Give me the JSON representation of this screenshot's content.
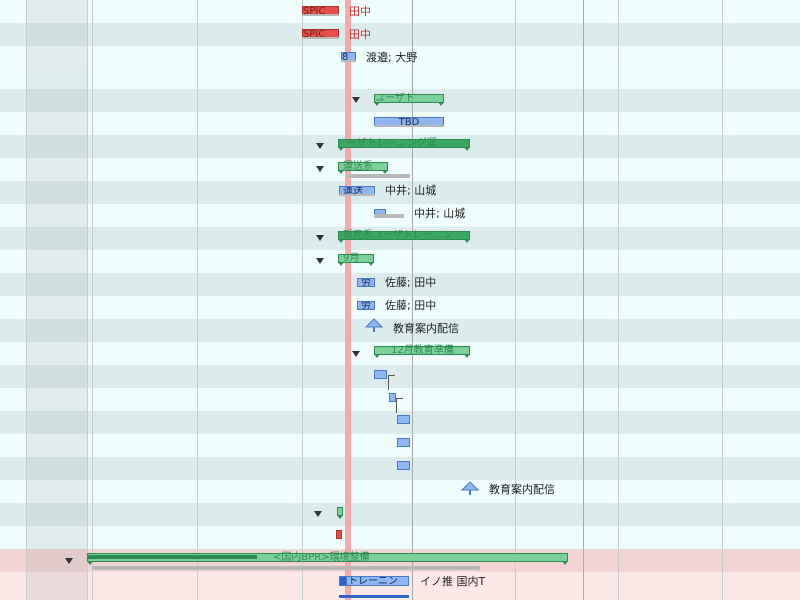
{
  "rows": [
    {
      "bar_text": "SPIC",
      "resource": "田中"
    },
    {
      "bar_text": "SPIC",
      "resource": "田中"
    },
    {
      "bar_text": "8",
      "resource": "渡邉; 大野"
    },
    {
      "bar_text": "",
      "resource": ""
    },
    {
      "bar_text": "ユーザト",
      "resource": ""
    },
    {
      "bar_text": "TBD",
      "resource": ""
    },
    {
      "bar_text": "ーザトレーニング運",
      "resource": ""
    },
    {
      "bar_text": "運送系",
      "resource": ""
    },
    {
      "bar_text": "運送",
      "resource": "中井; 山城"
    },
    {
      "bar_text": "",
      "resource": "中井; 山城"
    },
    {
      "bar_text": "販売系ユーザトレーニン",
      "resource": ""
    },
    {
      "bar_text": "9月",
      "resource": ""
    },
    {
      "bar_text": "労",
      "resource": "佐藤; 田中"
    },
    {
      "bar_text": "労",
      "resource": "佐藤; 田中"
    },
    {
      "bar_text": "",
      "resource": "教育案内配信"
    },
    {
      "bar_text": "12月教育準備",
      "resource": ""
    },
    {
      "bar_text": "",
      "resource": ""
    },
    {
      "bar_text": "",
      "resource": ""
    },
    {
      "bar_text": "",
      "resource": ""
    },
    {
      "bar_text": "",
      "resource": ""
    },
    {
      "bar_text": "",
      "resource": ""
    },
    {
      "bar_text": "",
      "resource": "教育案内配信"
    },
    {
      "bar_text": "",
      "resource": ""
    },
    {
      "bar_text": "",
      "resource": ""
    },
    {
      "bar_text": "<国内BPR>環境整備",
      "resource": ""
    },
    {
      "bar_text": "トレーニン",
      "resource": "イノ推 国内T"
    }
  ],
  "colors": {
    "summary": "#7ed09a",
    "task": "#8fb6f0",
    "critical": "#e55048",
    "today_line": "#f0a8aa",
    "highlight_row": "#f2d4d4"
  },
  "icons": [
    "collapse-triangle-icon",
    "milestone-arrow-icon"
  ]
}
